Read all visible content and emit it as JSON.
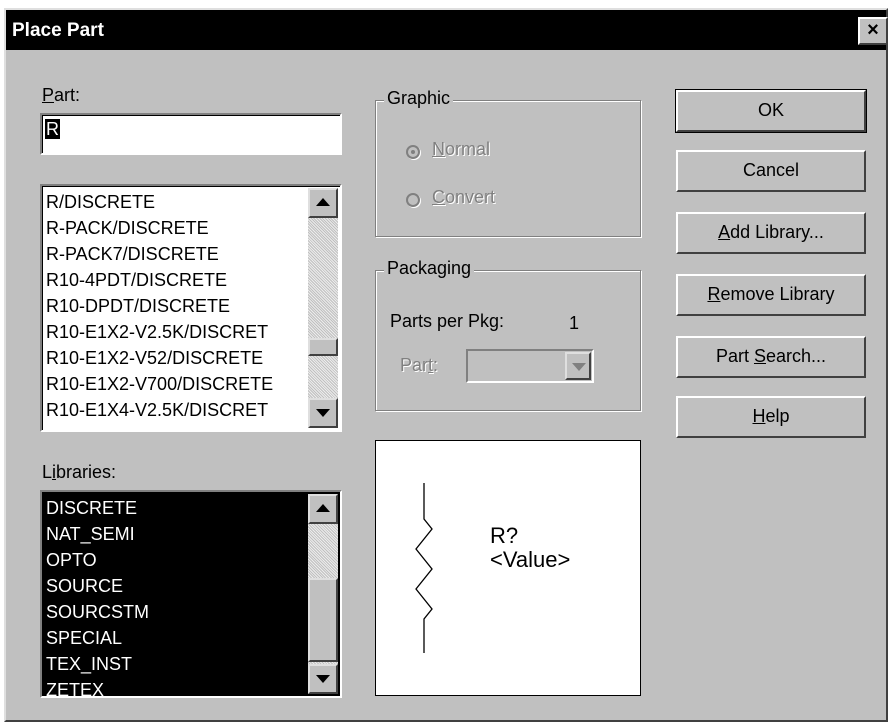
{
  "window": {
    "title": "Place Part",
    "close_glyph": "×"
  },
  "part_field": {
    "label_pre": "",
    "label_ul": "P",
    "label_post": "art:",
    "value": "R"
  },
  "parts_list": {
    "items": [
      "R/DISCRETE",
      "R-PACK/DISCRETE",
      "R-PACK7/DISCRETE",
      "R10-4PDT/DISCRETE",
      "R10-DPDT/DISCRETE",
      "R10-E1X2-V2.5K/DISCRET",
      "R10-E1X2-V52/DISCRETE",
      "R10-E1X2-V700/DISCRETE",
      "R10-E1X4-V2.5K/DISCRET"
    ]
  },
  "libraries": {
    "label_pre": "L",
    "label_ul": "i",
    "label_post": "braries:",
    "items": [
      "DISCRETE",
      "NAT_SEMI",
      "OPTO",
      "SOURCE",
      "SOURCSTM",
      "SPECIAL",
      "TEX_INST",
      "ZETEX"
    ]
  },
  "graphic": {
    "title": "Graphic",
    "normal": {
      "ul": "N",
      "rest": "ormal",
      "checked": true
    },
    "convert": {
      "ul": "C",
      "rest": "onvert",
      "checked": false
    }
  },
  "packaging": {
    "title": "Packaging",
    "parts_per_pkg_label": "Parts per Pkg:",
    "parts_per_pkg_value": "1",
    "part_label_pre": "Par",
    "part_label_ul": "t",
    "part_label_post": ":",
    "part_value": ""
  },
  "buttons": {
    "ok": "OK",
    "cancel": "Cancel",
    "add_library": {
      "ul": "A",
      "rest": "dd Library..."
    },
    "remove_library": {
      "ul": "R",
      "rest": "emove Library"
    },
    "part_search": {
      "pre": "Part ",
      "ul": "S",
      "rest": "earch..."
    },
    "help": {
      "ul": "H",
      "rest": "elp"
    }
  },
  "preview": {
    "reference": "R?",
    "value": "<Value>"
  },
  "colors": {
    "dialog_bg": "#c0c0c0",
    "titlebar_bg": "#000000",
    "selection_bg": "#000000"
  },
  "icons": [
    "close-icon",
    "scroll-up-icon",
    "scroll-down-icon",
    "dropdown-arrow-icon",
    "resistor-symbol-icon"
  ]
}
